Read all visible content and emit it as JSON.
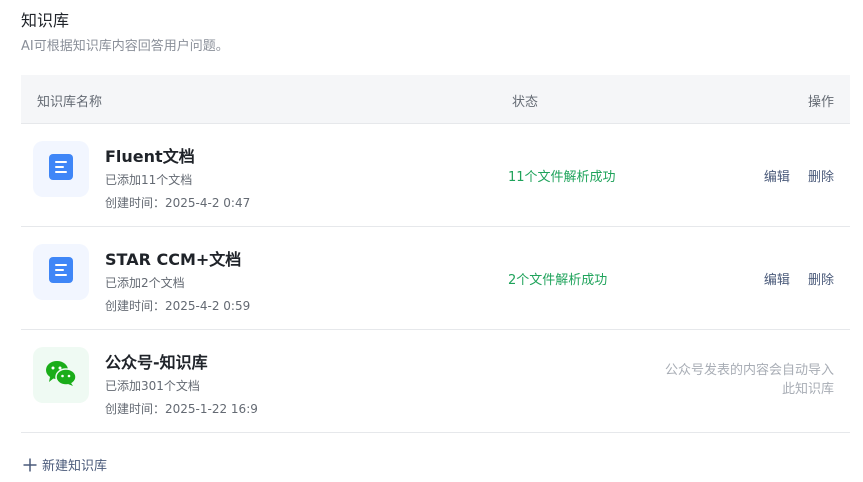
{
  "header": {
    "title": "知识库",
    "description": "AI可根据知识库内容回答用户问题。"
  },
  "table": {
    "columns": {
      "name": "知识库名称",
      "status": "状态",
      "actions": "操作"
    },
    "rows": [
      {
        "icon": "doc-icon",
        "name": "Fluent文档",
        "count": "已添加11个文档",
        "created": "创建时间：2025-4-2 0:47",
        "status": "11个文件解析成功",
        "edit": "编辑",
        "delete": "删除"
      },
      {
        "icon": "doc-icon",
        "name": "STAR CCM+文档",
        "count": "已添加2个文档",
        "created": "创建时间：2025-4-2 0:59",
        "status": "2个文件解析成功",
        "edit": "编辑",
        "delete": "删除"
      },
      {
        "icon": "wechat-icon",
        "name": "公众号-知识库",
        "count": "已添加301个文档",
        "created": "创建时间：2025-1-22 16:9",
        "note": "公众号发表的内容会自动导入此知识库"
      }
    ]
  },
  "footer": {
    "new_label": "新建知识库"
  },
  "colors": {
    "success": "#1fa35b",
    "doc_icon": "#3f86f7",
    "wechat_icon": "#1aad19",
    "action_text": "#4a5a7a"
  }
}
